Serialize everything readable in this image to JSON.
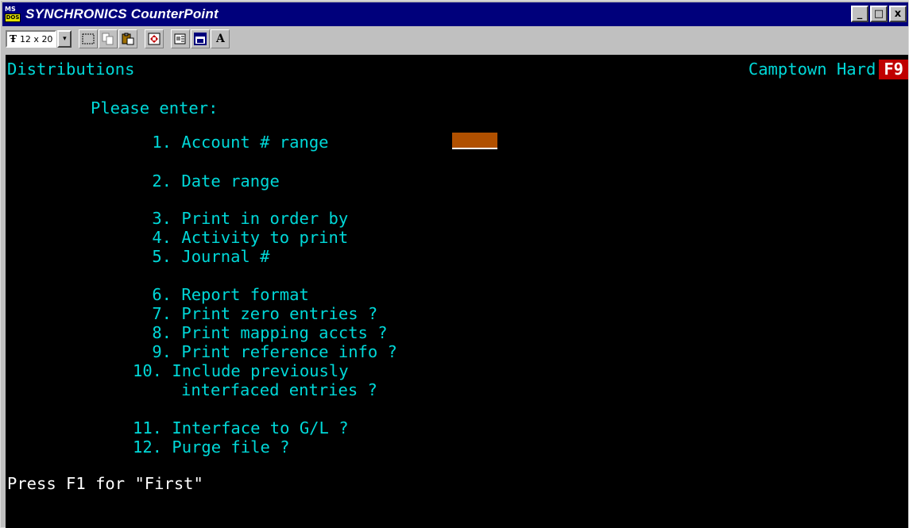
{
  "window": {
    "title": "SYNCHRONICS CounterPoint",
    "icon_text_top": "MS",
    "icon_text_bottom": "DOS",
    "buttons": {
      "minimize": "_",
      "maximize": "□",
      "close": "x"
    }
  },
  "toolbar": {
    "font_size_value": "12 x 20",
    "font_icon": "Ŧ",
    "dropdown_icon": "▾",
    "font_button_label": "A",
    "icons": [
      "mark-icon",
      "copy-icon",
      "paste-icon",
      "fullscreen-icon",
      "properties-icon",
      "background-icon",
      "font-icon"
    ]
  },
  "screen": {
    "title": "Distributions",
    "company": "Camptown Hard",
    "hotkey_badge": "F9",
    "prompt": "Please enter:",
    "menu_items": [
      {
        "num": " 1.",
        "label": "Account # range"
      },
      {
        "num": " 2.",
        "label": "Date range"
      },
      {
        "num": " 3.",
        "label": "Print in order by"
      },
      {
        "num": " 4.",
        "label": "Activity to print"
      },
      {
        "num": " 5.",
        "label": "Journal #"
      },
      {
        "num": " 6.",
        "label": "Report format"
      },
      {
        "num": " 7.",
        "label": "Print zero entries ?"
      },
      {
        "num": " 8.",
        "label": "Print mapping accts ?"
      },
      {
        "num": " 9.",
        "label": "Print reference info ?"
      },
      {
        "num": "10.",
        "label": "Include previously"
      },
      {
        "num": "",
        "label": "interfaced entries ?"
      },
      {
        "num": "11.",
        "label": "Interface to G/L ?"
      },
      {
        "num": "12.",
        "label": "Purge file ?"
      }
    ],
    "status": "Press F1 for \"First\""
  },
  "colors": {
    "terminal_bg": "#000000",
    "terminal_text": "#00d8d8",
    "status_text": "#ffffff",
    "title_bar": "#00007b",
    "cursor": "#b05000",
    "hotkey_bg": "#c00000"
  }
}
